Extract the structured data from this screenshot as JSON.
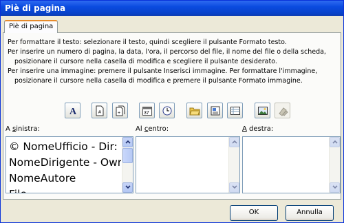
{
  "window": {
    "title": "Piè di pagina"
  },
  "tabs": [
    {
      "label": "Piè di pagina"
    }
  ],
  "instructions": [
    "Per formattare il testo: selezionare il testo, quindi scegliere il pulsante Formato testo.",
    "Per inserire un numero di pagina, la data, l'ora, il percorso del file, il nome del file o della scheda,",
    "posizionare il cursore nella casella di modifica e scegliere il pulsante desiderato.",
    "Per inserire una immagine: premere il pulsante Inserisci immagine. Per formattare l'immagine,",
    "posizionare il cursore nella casella di modifica e premere il pulsante Formato immagine."
  ],
  "toolbar": [
    {
      "icon": "format-text-icon"
    },
    {
      "icon": "page-number-icon"
    },
    {
      "icon": "page-count-icon"
    },
    {
      "icon": "date-icon"
    },
    {
      "icon": "time-icon"
    },
    {
      "icon": "file-path-icon"
    },
    {
      "icon": "file-name-icon"
    },
    {
      "icon": "sheet-name-icon"
    },
    {
      "icon": "insert-picture-icon"
    },
    {
      "icon": "format-picture-icon"
    }
  ],
  "sections": {
    "left": {
      "label_pre": "A ",
      "label_accel": "s",
      "label_post": "inistra:",
      "lines": [
        "© NomeUfficio - Dir:",
        "NomeDirigente - Owr",
        "NomeAutore",
        "File..."
      ]
    },
    "center": {
      "label_pre": "Al ",
      "label_accel": "c",
      "label_post": "entro:",
      "lines": []
    },
    "right": {
      "label_pre": "",
      "label_accel": "A",
      "label_post": " destra:",
      "lines": []
    }
  },
  "buttons": {
    "ok": "OK",
    "cancel": "Annulla"
  },
  "colors": {
    "titlebar": "#0a4be0",
    "dialog_bg": "#ece9d8",
    "tab_highlight": "#e68b2c",
    "border": "#7f9db9"
  }
}
